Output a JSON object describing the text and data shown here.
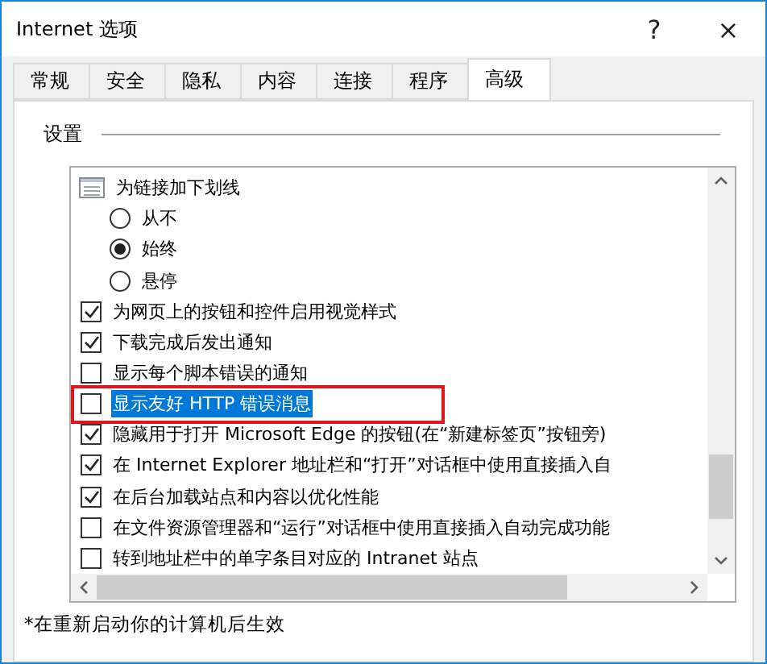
{
  "window": {
    "title": "Internet 选项",
    "help": "?",
    "close": "×"
  },
  "tabs": [
    {
      "label": "常规",
      "selected": false
    },
    {
      "label": "安全",
      "selected": false
    },
    {
      "label": "隐私",
      "selected": false
    },
    {
      "label": "内容",
      "selected": false
    },
    {
      "label": "连接",
      "selected": false
    },
    {
      "label": "程序",
      "selected": false
    },
    {
      "label": "高级",
      "selected": true
    }
  ],
  "settings": {
    "heading": "设置",
    "items": [
      {
        "kind": "group",
        "label": "为链接加下划线",
        "children": [
          {
            "kind": "radio",
            "label": "从不",
            "selected": false
          },
          {
            "kind": "radio",
            "label": "始终",
            "selected": true
          },
          {
            "kind": "radio",
            "label": "悬停",
            "selected": false
          }
        ]
      },
      {
        "kind": "checkbox",
        "label": "为网页上的按钮和控件启用视觉样式",
        "checked": true,
        "selected": false,
        "marked": false
      },
      {
        "kind": "checkbox",
        "label": "下载完成后发出通知",
        "checked": true,
        "selected": false,
        "marked": false
      },
      {
        "kind": "checkbox",
        "label": "显示每个脚本错误的通知",
        "checked": false,
        "selected": false,
        "marked": false
      },
      {
        "kind": "checkbox",
        "label": "显示友好 HTTP 错误消息",
        "checked": false,
        "selected": true,
        "marked": true
      },
      {
        "kind": "checkbox",
        "label": "隐藏用于打开 Microsoft Edge 的按钮(在“新建标签页”按钮旁)",
        "checked": true,
        "selected": false,
        "marked": false
      },
      {
        "kind": "checkbox",
        "label": "在 Internet Explorer 地址栏和“打开”对话框中使用直接插入自",
        "checked": true,
        "selected": false,
        "marked": false
      },
      {
        "kind": "checkbox",
        "label": "在后台加载站点和内容以优化性能",
        "checked": true,
        "selected": false,
        "marked": false
      },
      {
        "kind": "checkbox",
        "label": "在文件资源管理器和“运行”对话框中使用直接插入自动完成功能",
        "checked": false,
        "selected": false,
        "marked": false
      },
      {
        "kind": "checkbox",
        "label": "转到地址栏中的单字条目对应的 Intranet 站点",
        "checked": false,
        "selected": false,
        "marked": false
      }
    ]
  },
  "footnote": "*在重新启动你的计算机后生效"
}
